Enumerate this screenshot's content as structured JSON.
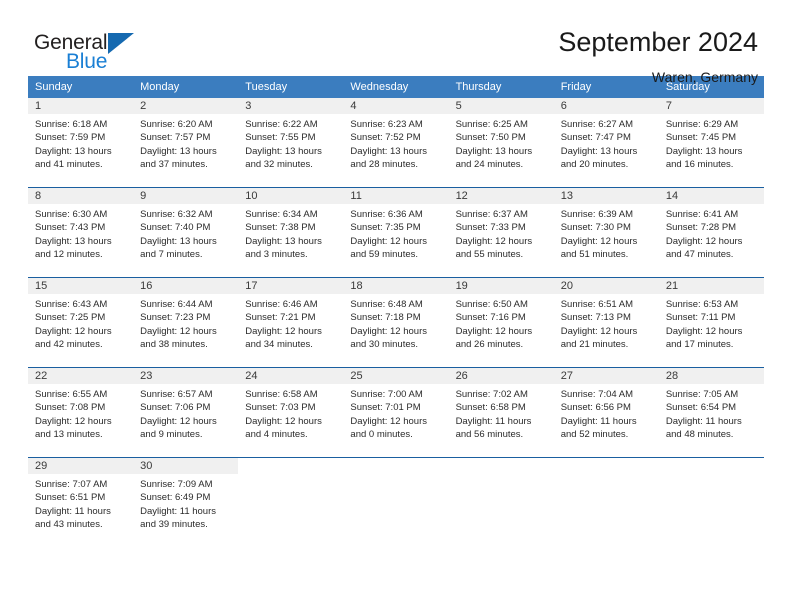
{
  "brand": {
    "name_top": "General",
    "name_bottom": "Blue",
    "flag_color": "#1569b0",
    "blue_text_color": "#1a7fd4"
  },
  "header": {
    "title": "September 2024",
    "location": "Waren, Germany"
  },
  "theme": {
    "header_row_bg": "#3b7dbf",
    "header_row_text": "#ffffff",
    "daynum_band_bg": "#f0f0f0",
    "grid_line": "#1a5fa0",
    "body_text": "#2b2b2b"
  },
  "weekdays": [
    "Sunday",
    "Monday",
    "Tuesday",
    "Wednesday",
    "Thursday",
    "Friday",
    "Saturday"
  ],
  "weeks": [
    [
      {
        "day": "1",
        "lines": [
          "Sunrise: 6:18 AM",
          "Sunset: 7:59 PM",
          "Daylight: 13 hours",
          "and 41 minutes."
        ]
      },
      {
        "day": "2",
        "lines": [
          "Sunrise: 6:20 AM",
          "Sunset: 7:57 PM",
          "Daylight: 13 hours",
          "and 37 minutes."
        ]
      },
      {
        "day": "3",
        "lines": [
          "Sunrise: 6:22 AM",
          "Sunset: 7:55 PM",
          "Daylight: 13 hours",
          "and 32 minutes."
        ]
      },
      {
        "day": "4",
        "lines": [
          "Sunrise: 6:23 AM",
          "Sunset: 7:52 PM",
          "Daylight: 13 hours",
          "and 28 minutes."
        ]
      },
      {
        "day": "5",
        "lines": [
          "Sunrise: 6:25 AM",
          "Sunset: 7:50 PM",
          "Daylight: 13 hours",
          "and 24 minutes."
        ]
      },
      {
        "day": "6",
        "lines": [
          "Sunrise: 6:27 AM",
          "Sunset: 7:47 PM",
          "Daylight: 13 hours",
          "and 20 minutes."
        ]
      },
      {
        "day": "7",
        "lines": [
          "Sunrise: 6:29 AM",
          "Sunset: 7:45 PM",
          "Daylight: 13 hours",
          "and 16 minutes."
        ]
      }
    ],
    [
      {
        "day": "8",
        "lines": [
          "Sunrise: 6:30 AM",
          "Sunset: 7:43 PM",
          "Daylight: 13 hours",
          "and 12 minutes."
        ]
      },
      {
        "day": "9",
        "lines": [
          "Sunrise: 6:32 AM",
          "Sunset: 7:40 PM",
          "Daylight: 13 hours",
          "and 7 minutes."
        ]
      },
      {
        "day": "10",
        "lines": [
          "Sunrise: 6:34 AM",
          "Sunset: 7:38 PM",
          "Daylight: 13 hours",
          "and 3 minutes."
        ]
      },
      {
        "day": "11",
        "lines": [
          "Sunrise: 6:36 AM",
          "Sunset: 7:35 PM",
          "Daylight: 12 hours",
          "and 59 minutes."
        ]
      },
      {
        "day": "12",
        "lines": [
          "Sunrise: 6:37 AM",
          "Sunset: 7:33 PM",
          "Daylight: 12 hours",
          "and 55 minutes."
        ]
      },
      {
        "day": "13",
        "lines": [
          "Sunrise: 6:39 AM",
          "Sunset: 7:30 PM",
          "Daylight: 12 hours",
          "and 51 minutes."
        ]
      },
      {
        "day": "14",
        "lines": [
          "Sunrise: 6:41 AM",
          "Sunset: 7:28 PM",
          "Daylight: 12 hours",
          "and 47 minutes."
        ]
      }
    ],
    [
      {
        "day": "15",
        "lines": [
          "Sunrise: 6:43 AM",
          "Sunset: 7:25 PM",
          "Daylight: 12 hours",
          "and 42 minutes."
        ]
      },
      {
        "day": "16",
        "lines": [
          "Sunrise: 6:44 AM",
          "Sunset: 7:23 PM",
          "Daylight: 12 hours",
          "and 38 minutes."
        ]
      },
      {
        "day": "17",
        "lines": [
          "Sunrise: 6:46 AM",
          "Sunset: 7:21 PM",
          "Daylight: 12 hours",
          "and 34 minutes."
        ]
      },
      {
        "day": "18",
        "lines": [
          "Sunrise: 6:48 AM",
          "Sunset: 7:18 PM",
          "Daylight: 12 hours",
          "and 30 minutes."
        ]
      },
      {
        "day": "19",
        "lines": [
          "Sunrise: 6:50 AM",
          "Sunset: 7:16 PM",
          "Daylight: 12 hours",
          "and 26 minutes."
        ]
      },
      {
        "day": "20",
        "lines": [
          "Sunrise: 6:51 AM",
          "Sunset: 7:13 PM",
          "Daylight: 12 hours",
          "and 21 minutes."
        ]
      },
      {
        "day": "21",
        "lines": [
          "Sunrise: 6:53 AM",
          "Sunset: 7:11 PM",
          "Daylight: 12 hours",
          "and 17 minutes."
        ]
      }
    ],
    [
      {
        "day": "22",
        "lines": [
          "Sunrise: 6:55 AM",
          "Sunset: 7:08 PM",
          "Daylight: 12 hours",
          "and 13 minutes."
        ]
      },
      {
        "day": "23",
        "lines": [
          "Sunrise: 6:57 AM",
          "Sunset: 7:06 PM",
          "Daylight: 12 hours",
          "and 9 minutes."
        ]
      },
      {
        "day": "24",
        "lines": [
          "Sunrise: 6:58 AM",
          "Sunset: 7:03 PM",
          "Daylight: 12 hours",
          "and 4 minutes."
        ]
      },
      {
        "day": "25",
        "lines": [
          "Sunrise: 7:00 AM",
          "Sunset: 7:01 PM",
          "Daylight: 12 hours",
          "and 0 minutes."
        ]
      },
      {
        "day": "26",
        "lines": [
          "Sunrise: 7:02 AM",
          "Sunset: 6:58 PM",
          "Daylight: 11 hours",
          "and 56 minutes."
        ]
      },
      {
        "day": "27",
        "lines": [
          "Sunrise: 7:04 AM",
          "Sunset: 6:56 PM",
          "Daylight: 11 hours",
          "and 52 minutes."
        ]
      },
      {
        "day": "28",
        "lines": [
          "Sunrise: 7:05 AM",
          "Sunset: 6:54 PM",
          "Daylight: 11 hours",
          "and 48 minutes."
        ]
      }
    ],
    [
      {
        "day": "29",
        "lines": [
          "Sunrise: 7:07 AM",
          "Sunset: 6:51 PM",
          "Daylight: 11 hours",
          "and 43 minutes."
        ]
      },
      {
        "day": "30",
        "lines": [
          "Sunrise: 7:09 AM",
          "Sunset: 6:49 PM",
          "Daylight: 11 hours",
          "and 39 minutes."
        ]
      },
      {
        "day": "",
        "lines": []
      },
      {
        "day": "",
        "lines": []
      },
      {
        "day": "",
        "lines": []
      },
      {
        "day": "",
        "lines": []
      },
      {
        "day": "",
        "lines": []
      }
    ]
  ]
}
